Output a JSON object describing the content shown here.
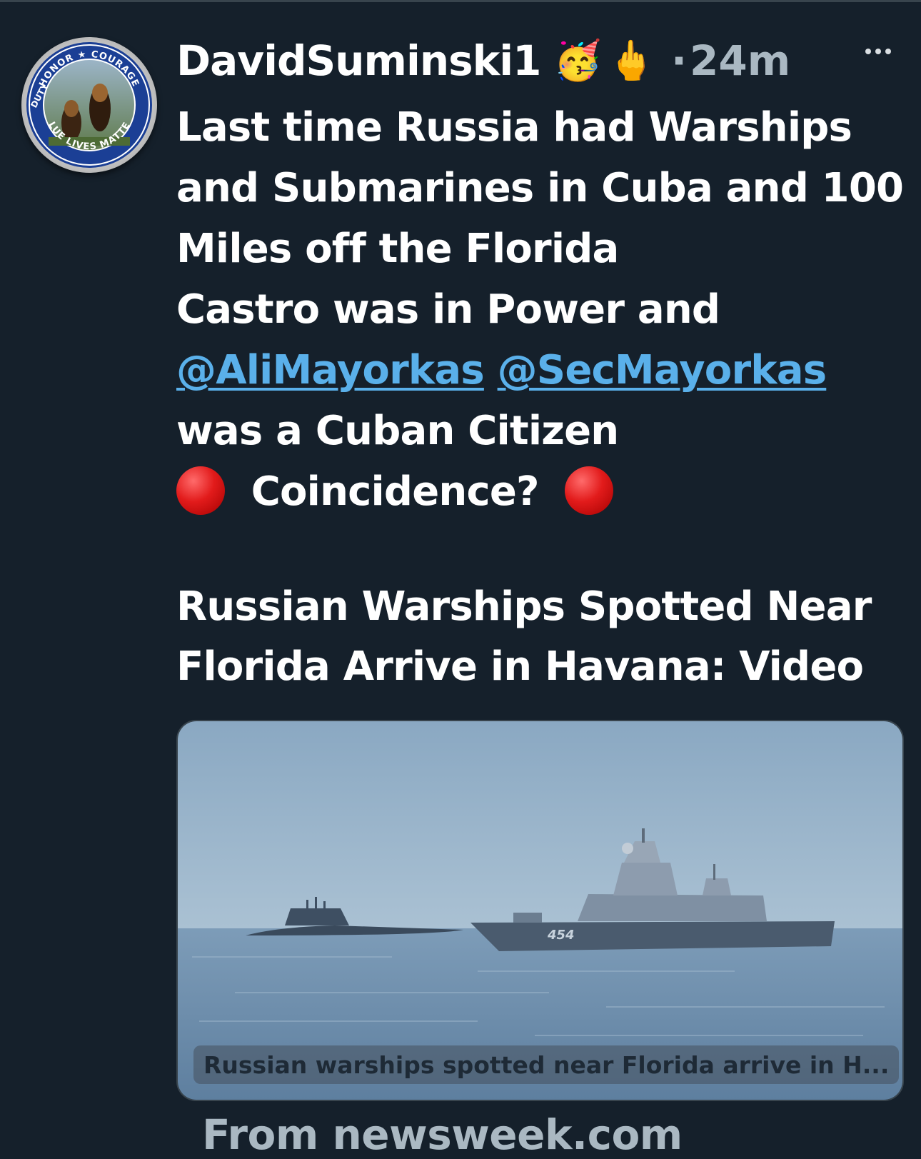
{
  "tweet": {
    "username": "DavidSuminski1",
    "emojis": [
      "🥳",
      "🖕"
    ],
    "separator": "·",
    "timestamp": "24m",
    "lines": {
      "l1": "Last time Russia had Warships",
      "l2": "and Submarines in Cuba and 100",
      "l3": "Miles off the Florida",
      "l4": "Castro was in Power and",
      "mention1": "@AliMayorkas",
      "mention2": "@SecMayorkas",
      "l6": "was a Cuban Citizen",
      "l7": "Coincidence?"
    },
    "headline": {
      "line1": "Russian Warships Spotted Near",
      "line2": "Florida Arrive in Havana: Video"
    }
  },
  "avatar": {
    "top_text": "HONOR ★ COURAGE",
    "left_text": "DUTY",
    "bottom_text": "BLUE LIVES MATTER"
  },
  "link_card": {
    "caption": "Russian warships spotted near Florida arrive in H...",
    "hull_number": "454"
  },
  "source": "From newsweek.com",
  "colors": {
    "background": "#15202b",
    "text": "#ffffff",
    "muted": "#aab8c2",
    "link": "#5ab0ea"
  }
}
